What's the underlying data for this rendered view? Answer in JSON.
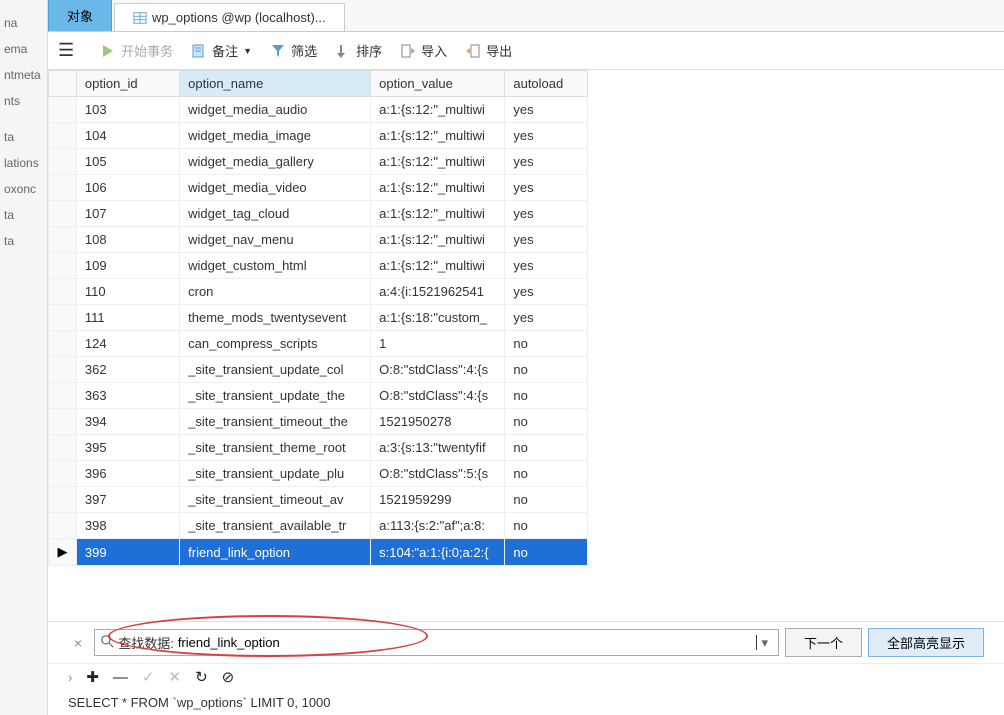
{
  "sidebar": {
    "items": [
      "na",
      "ema",
      "ntmeta",
      "nts",
      "ta",
      "lations",
      "oxonc",
      "ta",
      "ta"
    ]
  },
  "tabs": [
    {
      "label": "对象",
      "active": true
    },
    {
      "label": "wp_options @wp (localhost)...",
      "active": false
    }
  ],
  "toolbar": {
    "begin_tx": "开始事务",
    "note": "备注",
    "filter": "筛选",
    "sort": "排序",
    "import": "导入",
    "export": "导出"
  },
  "columns": [
    "option_id",
    "option_name",
    "option_value",
    "autoload"
  ],
  "active_col": 1,
  "selected_row": 17,
  "rows": [
    {
      "id": "103",
      "name": "widget_media_audio",
      "value": "a:1:{s:12:\"_multiwi",
      "auto": "yes"
    },
    {
      "id": "104",
      "name": "widget_media_image",
      "value": "a:1:{s:12:\"_multiwi",
      "auto": "yes"
    },
    {
      "id": "105",
      "name": "widget_media_gallery",
      "value": "a:1:{s:12:\"_multiwi",
      "auto": "yes"
    },
    {
      "id": "106",
      "name": "widget_media_video",
      "value": "a:1:{s:12:\"_multiwi",
      "auto": "yes"
    },
    {
      "id": "107",
      "name": "widget_tag_cloud",
      "value": "a:1:{s:12:\"_multiwi",
      "auto": "yes"
    },
    {
      "id": "108",
      "name": "widget_nav_menu",
      "value": "a:1:{s:12:\"_multiwi",
      "auto": "yes"
    },
    {
      "id": "109",
      "name": "widget_custom_html",
      "value": "a:1:{s:12:\"_multiwi",
      "auto": "yes"
    },
    {
      "id": "110",
      "name": "cron",
      "value": "a:4:{i:1521962541",
      "auto": "yes"
    },
    {
      "id": "111",
      "name": "theme_mods_twentysevent",
      "value": "a:1:{s:18:\"custom_",
      "auto": "yes"
    },
    {
      "id": "124",
      "name": "can_compress_scripts",
      "value": "1",
      "auto": "no"
    },
    {
      "id": "362",
      "name": "_site_transient_update_col",
      "value": "O:8:\"stdClass\":4:{s",
      "auto": "no"
    },
    {
      "id": "363",
      "name": "_site_transient_update_the",
      "value": "O:8:\"stdClass\":4:{s",
      "auto": "no"
    },
    {
      "id": "394",
      "name": "_site_transient_timeout_the",
      "value": "1521950278",
      "auto": "no"
    },
    {
      "id": "395",
      "name": "_site_transient_theme_root",
      "value": "a:3:{s:13:\"twentyfif",
      "auto": "no"
    },
    {
      "id": "396",
      "name": "_site_transient_update_plu",
      "value": "O:8:\"stdClass\":5:{s",
      "auto": "no"
    },
    {
      "id": "397",
      "name": "_site_transient_timeout_av",
      "value": "1521959299",
      "auto": "no"
    },
    {
      "id": "398",
      "name": "_site_transient_available_tr",
      "value": "a:113:{s:2:\"af\";a:8:",
      "auto": "no"
    },
    {
      "id": "399",
      "name": "friend_link_option",
      "value": "s:104:\"a:1:{i:0;a:2:{",
      "auto": "no"
    }
  ],
  "search": {
    "prefix": "查找数据:",
    "value": "friend_link_option",
    "next": "下一个",
    "highlight_all": "全部高亮显示"
  },
  "sql": "SELECT * FROM `wp_options` LIMIT 0, 1000"
}
